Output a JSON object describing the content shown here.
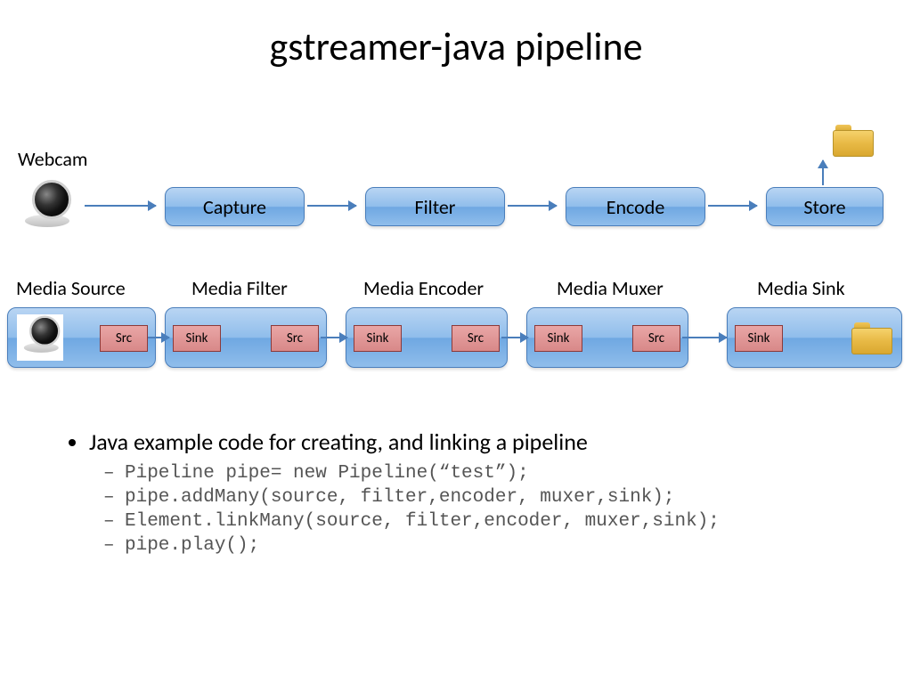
{
  "title": "gstreamer-java pipeline",
  "webcam_label": "Webcam",
  "stages": {
    "capture": "Capture",
    "filter": "Filter",
    "encode": "Encode",
    "store": "Store"
  },
  "media_labels": {
    "source": "Media Source",
    "filter": "Media Filter",
    "encoder": "Media Encoder",
    "muxer": "Media Muxer",
    "sink": "Media Sink"
  },
  "pad": {
    "src": "Src",
    "sink": "Sink"
  },
  "bullet_main": "Java example code for creating, and linking a pipeline",
  "code": {
    "l1": "Pipeline pipe= new Pipeline(“test”);",
    "l2": "pipe.addMany(source, filter,encoder, muxer,sink);",
    "l3": "Element.linkMany(source, filter,encoder, muxer,sink);",
    "l4": "pipe.play();"
  }
}
